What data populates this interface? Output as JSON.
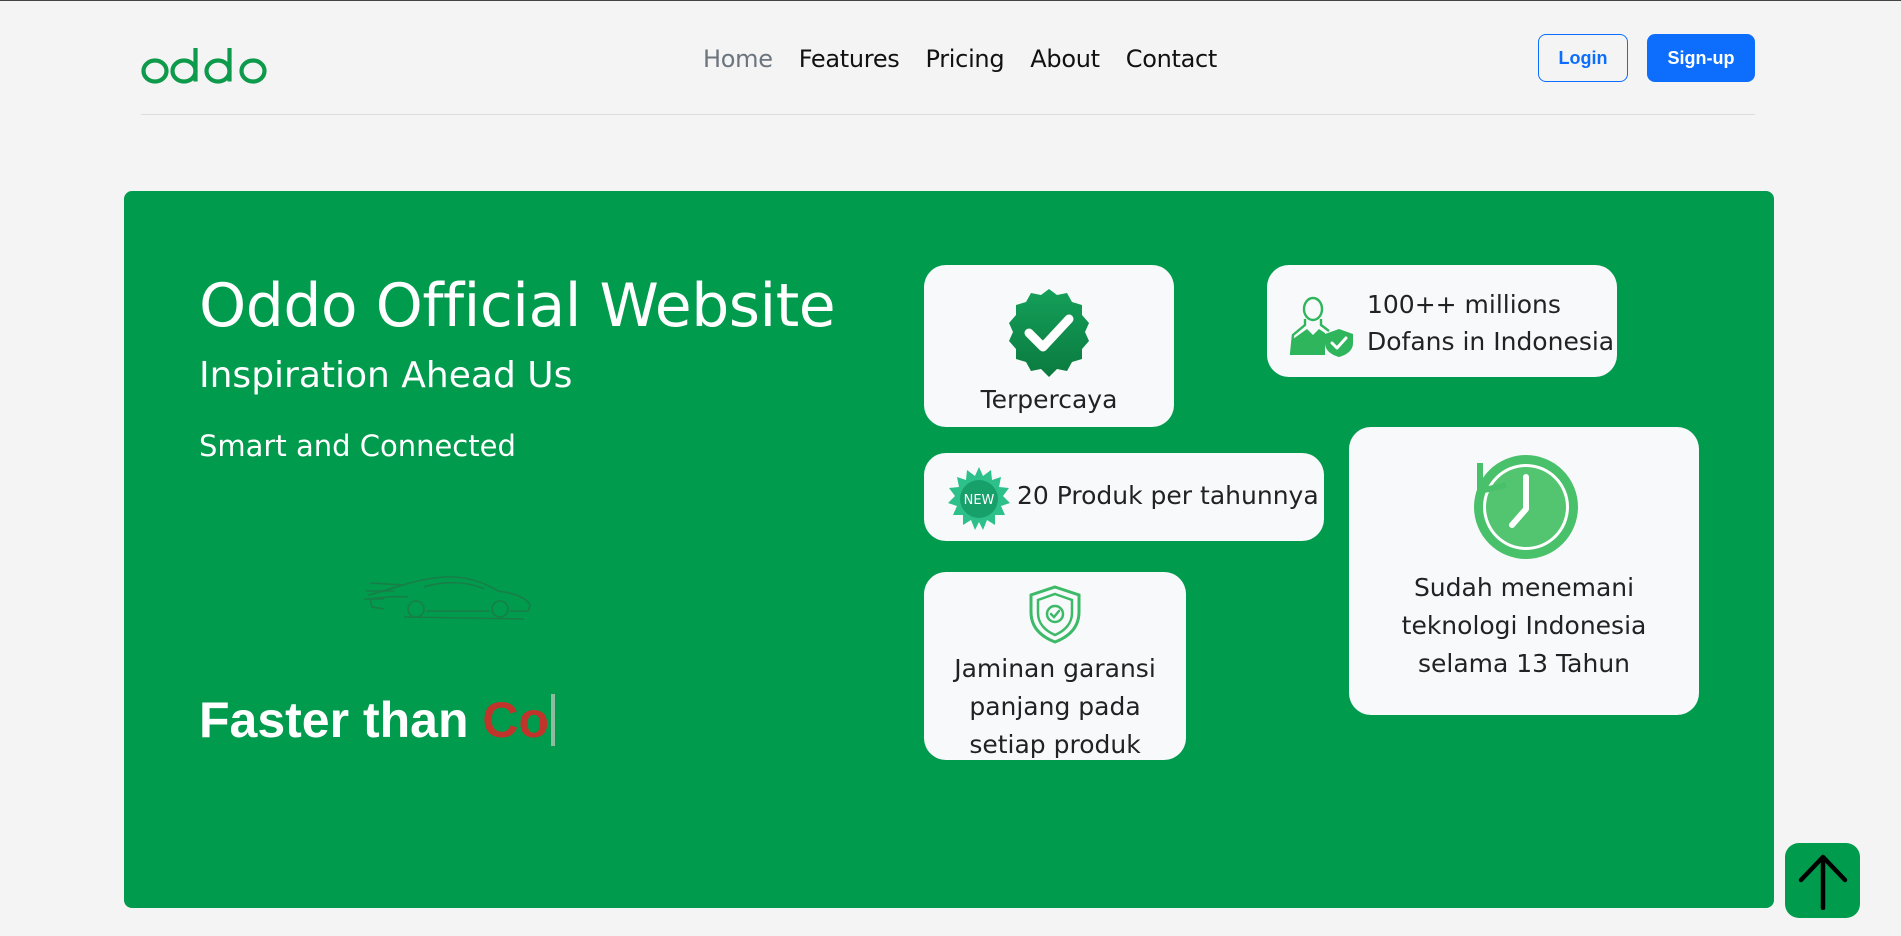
{
  "brand": {
    "logo_text": "oddo",
    "color": "#0e9a4b"
  },
  "nav": {
    "items": [
      {
        "label": "Home",
        "active": true
      },
      {
        "label": "Features",
        "active": false
      },
      {
        "label": "Pricing",
        "active": false
      },
      {
        "label": "About",
        "active": false
      },
      {
        "label": "Contact",
        "active": false
      }
    ]
  },
  "auth": {
    "login_label": "Login",
    "signup_label": "Sign-up",
    "accent": "#0d6efd"
  },
  "hero": {
    "background": "#009b4c",
    "title": "Oddo Official Website",
    "subtitle": "Inspiration Ahead Us",
    "tagline": "Smart and Connected",
    "typed_prefix": "Faster than ",
    "typed_partial": "Co",
    "typed_partial_color": "#c0342b"
  },
  "features": {
    "trusted": {
      "icon": "verified-badge-icon",
      "label": "Terpercaya"
    },
    "fans": {
      "icon": "user-shield-icon",
      "line1": "100++ millions",
      "line2": "Dofans in Indonesia"
    },
    "products": {
      "icon": "new-badge-icon",
      "badge_text": "NEW",
      "label": "20 Produk per tahunnya"
    },
    "warranty": {
      "icon": "shield-check-icon",
      "line1": "Jaminan garansi",
      "line2": "panjang pada",
      "line3": "setiap produk"
    },
    "history": {
      "icon": "clock-history-icon",
      "line1": "Sudah menemani",
      "line2": "teknologi Indonesia",
      "line3": "selama 13 Tahun"
    }
  },
  "scroll_top": {
    "icon": "arrow-up-icon"
  }
}
